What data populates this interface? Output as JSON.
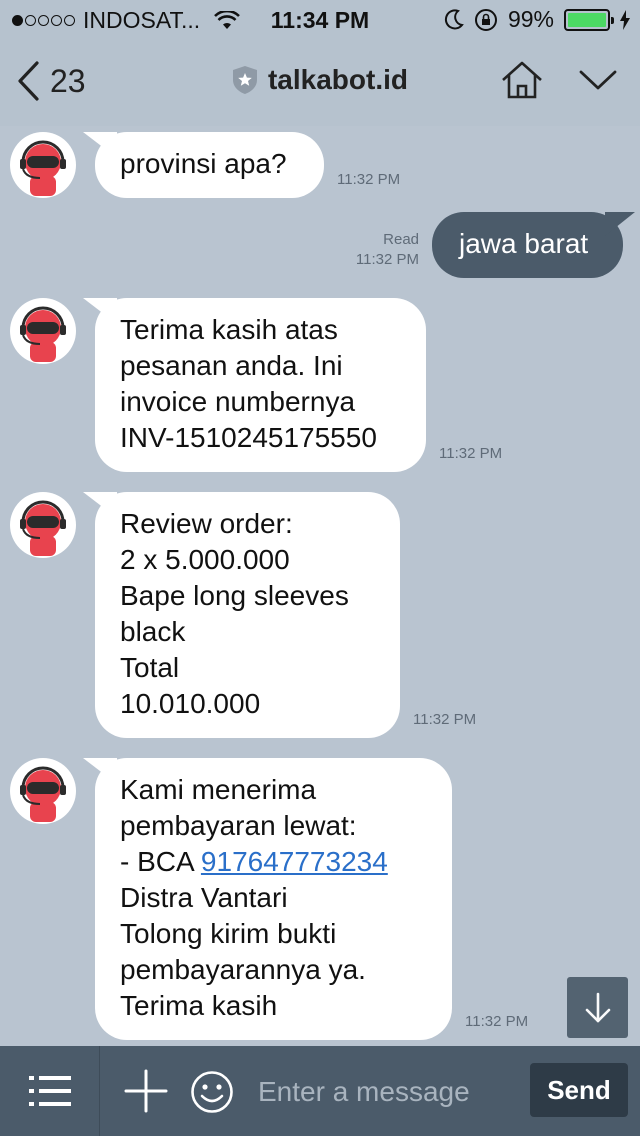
{
  "status_bar": {
    "carrier": "INDOSAT...",
    "time": "11:34 PM",
    "battery": "99%",
    "battery_level": 0.99,
    "icons": [
      "signal-dots-icon",
      "wifi-icon",
      "moon-icon",
      "rotation-lock-icon",
      "battery-icon",
      "charging-bolt-icon"
    ]
  },
  "nav": {
    "back_count": "23",
    "title": "talkabot.id",
    "icons": [
      "back-chevron-icon",
      "official-badge-icon",
      "home-icon",
      "chevron-down-icon"
    ]
  },
  "messages": [
    {
      "from": "bot",
      "lines": [
        "provinsi apa?"
      ],
      "time": "11:32 PM"
    },
    {
      "from": "me",
      "lines": [
        "jawa barat"
      ],
      "status": "Read",
      "time": "11:32 PM"
    },
    {
      "from": "bot",
      "lines": [
        "Terima kasih atas",
        "pesanan anda. Ini",
        "invoice numbernya",
        "INV-1510245175550"
      ],
      "time": "11:32 PM"
    },
    {
      "from": "bot",
      "lines": [
        "Review order:",
        "2 x 5.000.000",
        "Bape long sleeves",
        "black",
        "Total",
        "10.010.000"
      ],
      "time": "11:32 PM"
    },
    {
      "from": "bot",
      "lines_prefix": "- BCA ",
      "link": "917647773234",
      "lines_before": [
        "Kami menerima",
        "pembayaran lewat:"
      ],
      "lines_after": [
        "Distra Vantari",
        "Tolong kirim bukti",
        "pembayarannya ya.",
        "Terima kasih"
      ],
      "time": "11:32 PM"
    }
  ],
  "composer": {
    "placeholder": "Enter a message",
    "send_label": "Send",
    "icons": [
      "menu-icon",
      "plus-icon",
      "emoji-icon",
      "arrow-down-icon"
    ]
  },
  "colors": {
    "chat_bg": "#b9c4d0",
    "outgoing_bubble": "#4b5b6a",
    "bottom_bar": "#4b5b6a",
    "link": "#2a6fc9",
    "avatar_red": "#e8434e"
  }
}
